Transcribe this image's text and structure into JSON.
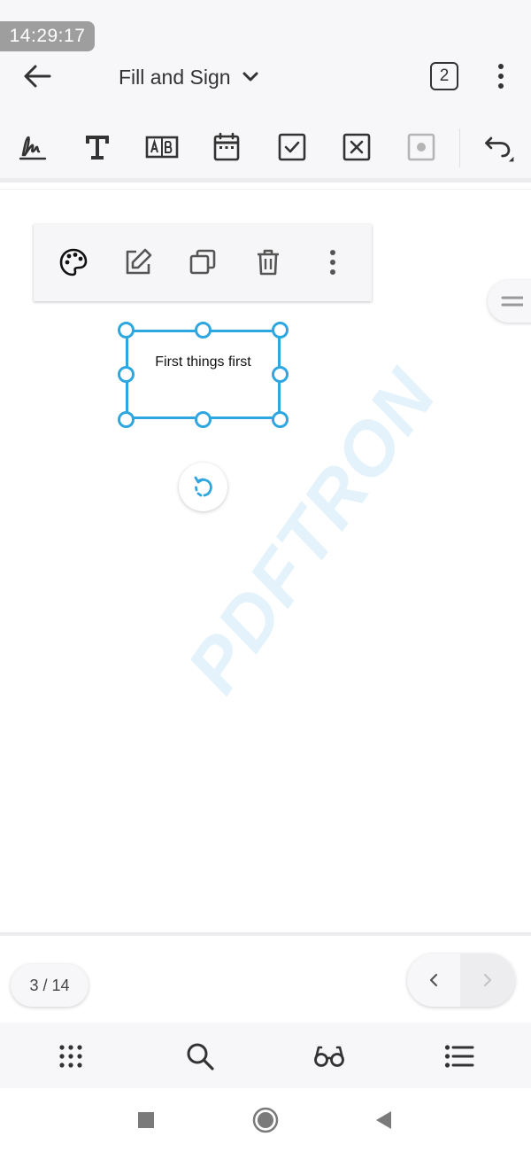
{
  "status": {
    "time": "14:29:17"
  },
  "header": {
    "title": "Fill and Sign",
    "tab_count": "2"
  },
  "toolbar": {
    "tools": [
      "signature-icon",
      "text-icon",
      "comb-text-icon",
      "date-icon",
      "checkmark-icon",
      "cross-icon",
      "dot-icon",
      "undo-icon"
    ]
  },
  "annotation_toolbar": {
    "items": [
      "palette-icon",
      "edit-icon",
      "copy-icon",
      "delete-icon",
      "more-vert-icon"
    ]
  },
  "document": {
    "text_box": "First things first",
    "watermark": "PDFTRON"
  },
  "pagination": {
    "label": "3 / 14"
  },
  "bottom_nav": {
    "items": [
      "grid-icon",
      "search-icon",
      "reading-glasses-icon",
      "list-icon"
    ]
  },
  "colors": {
    "accent": "#2ea6df",
    "icon": "#333333",
    "bar_bg": "#f7f7f9"
  }
}
